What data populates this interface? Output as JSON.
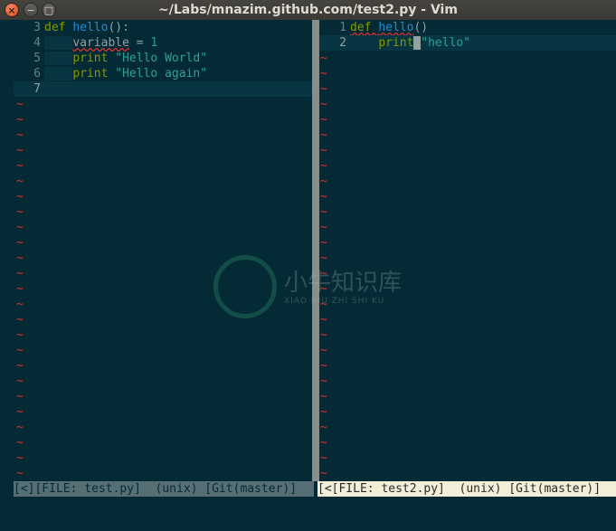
{
  "window": {
    "title": "~/Labs/mnazim.github.com/test2.py - Vim",
    "close_glyph": "×",
    "min_glyph": "−",
    "max_glyph": "□"
  },
  "left_pane": {
    "lines": [
      {
        "nr": "3",
        "tokens": [
          {
            "t": "def ",
            "c": "kw"
          },
          {
            "t": "hello",
            "c": "fn"
          },
          {
            "t": "():",
            "c": "tx"
          }
        ]
      },
      {
        "nr": "4",
        "tokens": [
          {
            "t": "    ",
            "c": "indentguide"
          },
          {
            "t": "variable",
            "c": "tx spell"
          },
          {
            "t": " = ",
            "c": "tx"
          },
          {
            "t": "1",
            "c": "num"
          }
        ]
      },
      {
        "nr": "5",
        "tokens": [
          {
            "t": "    ",
            "c": "indentguide"
          },
          {
            "t": "print ",
            "c": "kw"
          },
          {
            "t": "\"Hello World\"",
            "c": "str"
          }
        ]
      },
      {
        "nr": "6",
        "tokens": [
          {
            "t": "    ",
            "c": "indentguide"
          },
          {
            "t": "print ",
            "c": "kw"
          },
          {
            "t": "\"Hello again\"",
            "c": "str"
          }
        ]
      },
      {
        "nr": "7",
        "tokens": [],
        "cursorline": true
      }
    ],
    "status": "[<][FILE: test.py]  (unix) [Git(master)]"
  },
  "right_pane": {
    "lines": [
      {
        "nr": "1",
        "tokens": [
          {
            "t": "def ",
            "c": "kw spell"
          },
          {
            "t": "hello",
            "c": "fn spell"
          },
          {
            "t": "()",
            "c": "tx"
          }
        ]
      },
      {
        "nr": "2",
        "cursorline": true,
        "tokens": [
          {
            "t": "    ",
            "c": "indentguide"
          },
          {
            "t": "print",
            "c": "kw"
          },
          {
            "t": " ",
            "c": "cursor"
          },
          {
            "t": "\"hello\"",
            "c": "str"
          }
        ]
      }
    ],
    "status": "[<[FILE: test2.py]  (unix) [Git(master)]"
  },
  "tilde": "~",
  "colors": {
    "background": "#042b35",
    "tilde": "#dc322f",
    "keyword": "#859900",
    "string": "#2aa198",
    "function": "#268bd2"
  },
  "watermark": {
    "text": "小牛知识库",
    "sub": "XIAO NIU ZHI SHI KU"
  }
}
